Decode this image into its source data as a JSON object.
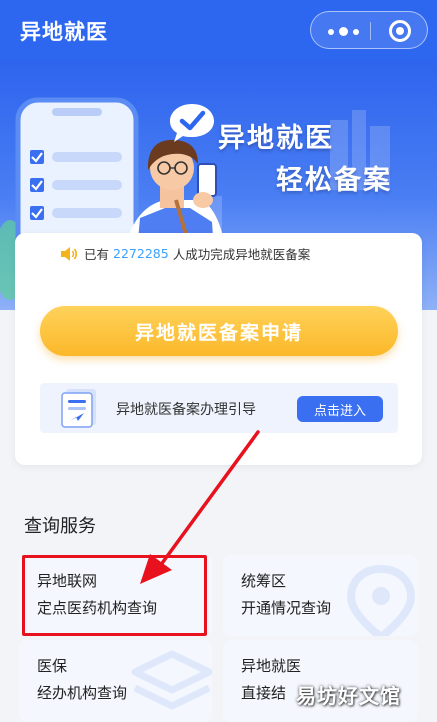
{
  "header": {
    "title": "异地就医"
  },
  "hero": {
    "title_line1": "异地就医",
    "title_line2": "轻松备案"
  },
  "notice": {
    "prefix": "已有",
    "count": "2272285",
    "suffix": "人成功完成异地就医备案"
  },
  "apply_button": {
    "label": "异地就医备案申请"
  },
  "guide": {
    "text": "异地就医备案办理引导",
    "button_label": "点击进入"
  },
  "query_section": {
    "title": "查询服务",
    "tiles": [
      {
        "line1": "异地联网",
        "line2": "定点医药机构查询"
      },
      {
        "line1": "统筹区",
        "line2": "开通情况查询"
      },
      {
        "line1": "医保",
        "line2": "经办机构查询"
      },
      {
        "line1": "异地就医",
        "line2": "直接结"
      }
    ]
  },
  "watermark": "易坊好文馆",
  "colors": {
    "primary": "#2d67f0",
    "accent_yellow": "#fbb82a",
    "count_blue": "#39a0ff",
    "annotation_red": "#e8121f"
  },
  "icons": [
    "menu-dots-icon",
    "target-icon",
    "speaker-icon",
    "document-icon",
    "location-pin-icon",
    "layers-icon"
  ]
}
